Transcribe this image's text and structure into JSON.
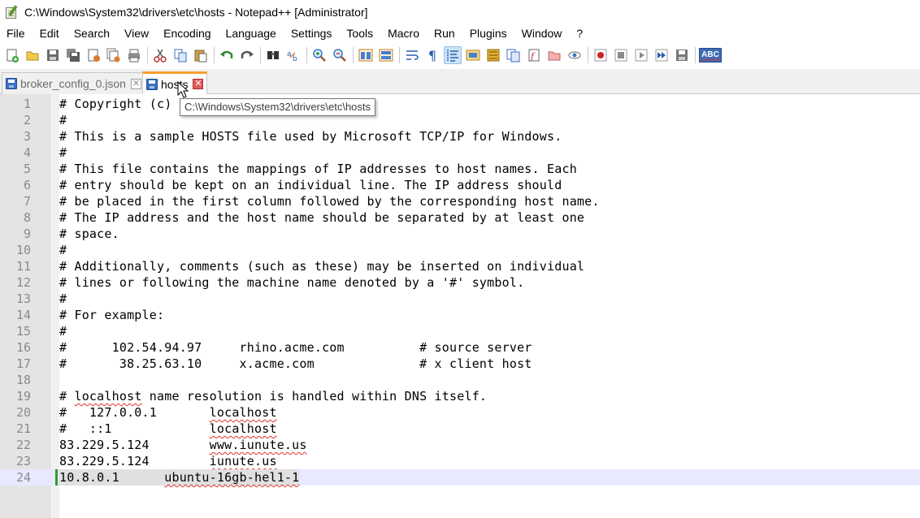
{
  "window": {
    "title": "C:\\Windows\\System32\\drivers\\etc\\hosts - Notepad++ [Administrator]"
  },
  "menu": [
    "File",
    "Edit",
    "Search",
    "View",
    "Encoding",
    "Language",
    "Settings",
    "Tools",
    "Macro",
    "Run",
    "Plugins",
    "Window",
    "?"
  ],
  "toolbar": {
    "spellcheck_label": "ABC"
  },
  "tabs": [
    {
      "label": "broker_config_0.json",
      "active": false
    },
    {
      "label": "hosts",
      "active": true
    }
  ],
  "tooltip": "C:\\Windows\\System32\\drivers\\etc\\hosts",
  "editor": {
    "current_line": 24,
    "lines": [
      {
        "n": "1",
        "text": "# Copyright (c)"
      },
      {
        "n": "2",
        "text": "#"
      },
      {
        "n": "3",
        "text": "# This is a sample HOSTS file used by Microsoft TCP/IP for Windows."
      },
      {
        "n": "4",
        "text": "#"
      },
      {
        "n": "5",
        "text": "# This file contains the mappings of IP addresses to host names. Each"
      },
      {
        "n": "6",
        "text": "# entry should be kept on an individual line. The IP address should"
      },
      {
        "n": "7",
        "text": "# be placed in the first column followed by the corresponding host name."
      },
      {
        "n": "8",
        "text": "# The IP address and the host name should be separated by at least one"
      },
      {
        "n": "9",
        "text": "# space."
      },
      {
        "n": "10",
        "text": "#"
      },
      {
        "n": "11",
        "text": "# Additionally, comments (such as these) may be inserted on individual"
      },
      {
        "n": "12",
        "text": "# lines or following the machine name denoted by a '#' symbol."
      },
      {
        "n": "13",
        "text": "#"
      },
      {
        "n": "14",
        "text": "# For example:"
      },
      {
        "n": "15",
        "text": "#"
      },
      {
        "n": "16",
        "text": "#      102.54.94.97     rhino.acme.com          # source server"
      },
      {
        "n": "17",
        "text": "#       38.25.63.10     x.acme.com              # x client host"
      },
      {
        "n": "18",
        "text": ""
      },
      {
        "n": "19",
        "text": "# localhost name resolution is handled within DNS itself."
      },
      {
        "n": "20",
        "text": "#   127.0.0.1       localhost"
      },
      {
        "n": "21",
        "text": "#   ::1             localhost"
      },
      {
        "n": "22",
        "text": "83.229.5.124        www.iunute.us"
      },
      {
        "n": "23",
        "text": "83.229.5.124        iunute.us"
      },
      {
        "n": "24",
        "text": "10.8.0.1      ubuntu-16gb-hel1-1"
      }
    ]
  }
}
